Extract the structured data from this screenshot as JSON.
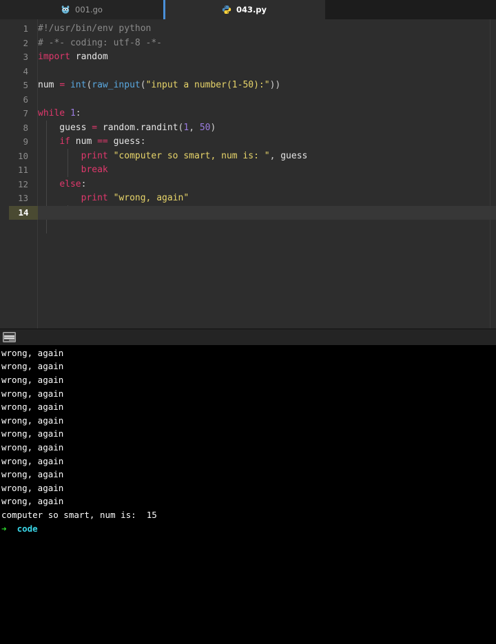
{
  "window": {
    "title": "043.py",
    "accent_color": "#4a90d9",
    "editor_bg": "#2d2d2d",
    "terminal_bg": "#000000"
  },
  "tabbar": {
    "tabs": [
      {
        "label": "001.go",
        "icon": "go-gopher-icon",
        "active": false
      },
      {
        "label": "043.py",
        "icon": "python-icon",
        "active": true
      }
    ]
  },
  "editor": {
    "language": "python",
    "current_line": 14,
    "line_numbers": [
      "1",
      "2",
      "3",
      "4",
      "5",
      "6",
      "7",
      "8",
      "9",
      "10",
      "11",
      "12",
      "13",
      "14"
    ],
    "lines": [
      {
        "n": 1,
        "text": "#!/usr/bin/env python"
      },
      {
        "n": 2,
        "text": "# -*- coding: utf-8 -*-"
      },
      {
        "n": 3,
        "text": "import random"
      },
      {
        "n": 4,
        "text": ""
      },
      {
        "n": 5,
        "text": "num = int(raw_input(\"input a number(1-50):\"))"
      },
      {
        "n": 6,
        "text": ""
      },
      {
        "n": 7,
        "text": "while 1:"
      },
      {
        "n": 8,
        "text": "    guess = random.randint(1, 50)"
      },
      {
        "n": 9,
        "text": "    if num == guess:"
      },
      {
        "n": 10,
        "text": "        print \"computer so smart, num is: \", guess"
      },
      {
        "n": 11,
        "text": "        break"
      },
      {
        "n": 12,
        "text": "    else:"
      },
      {
        "n": 13,
        "text": "        print \"wrong, again\""
      },
      {
        "n": 14,
        "text": ""
      }
    ],
    "colors": {
      "comment": "#8a8a8a",
      "keyword": "#e0386c",
      "function": "#5aa8e0",
      "string": "#e8d56a",
      "number": "#9b7ce0",
      "text": "#e6e6e6",
      "current_line_gutter": "#4a4a32"
    }
  },
  "terminal_panel": {
    "tab_icon": "console-icon",
    "lines": [
      "wrong, again",
      "wrong, again",
      "wrong, again",
      "wrong, again",
      "wrong, again",
      "wrong, again",
      "wrong, again",
      "wrong, again",
      "wrong, again",
      "wrong, again",
      "wrong, again",
      "wrong, again",
      "computer so smart, num is:  15"
    ],
    "prompt": {
      "arrow": "➜",
      "path": "code"
    }
  }
}
